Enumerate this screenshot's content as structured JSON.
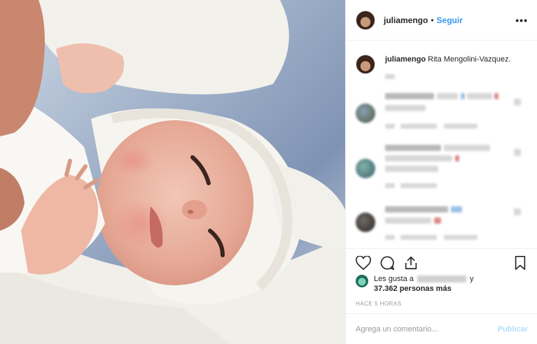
{
  "post": {
    "username": "juliamengo",
    "separator": "•",
    "follow_label": "Seguir",
    "more_label": "•••",
    "caption_user": "juliamengo",
    "caption_text": "Rita Mengolini-Vazquez."
  },
  "likes": {
    "prefix": "Les gusta a",
    "connector": "y",
    "count_text": "37.362 personas más"
  },
  "timestamp": "HACE 5 HORAS",
  "composer": {
    "placeholder": "Agrega un comentario...",
    "publish_label": "Publicar"
  },
  "icons": {
    "like": "heart-icon",
    "comment": "comment-icon",
    "share": "share-icon",
    "save": "bookmark-icon",
    "more": "more-icon"
  },
  "colors": {
    "link": "#3897f0",
    "publish_disabled": "#b2dffc",
    "muted": "#999999",
    "border": "#efefef"
  }
}
